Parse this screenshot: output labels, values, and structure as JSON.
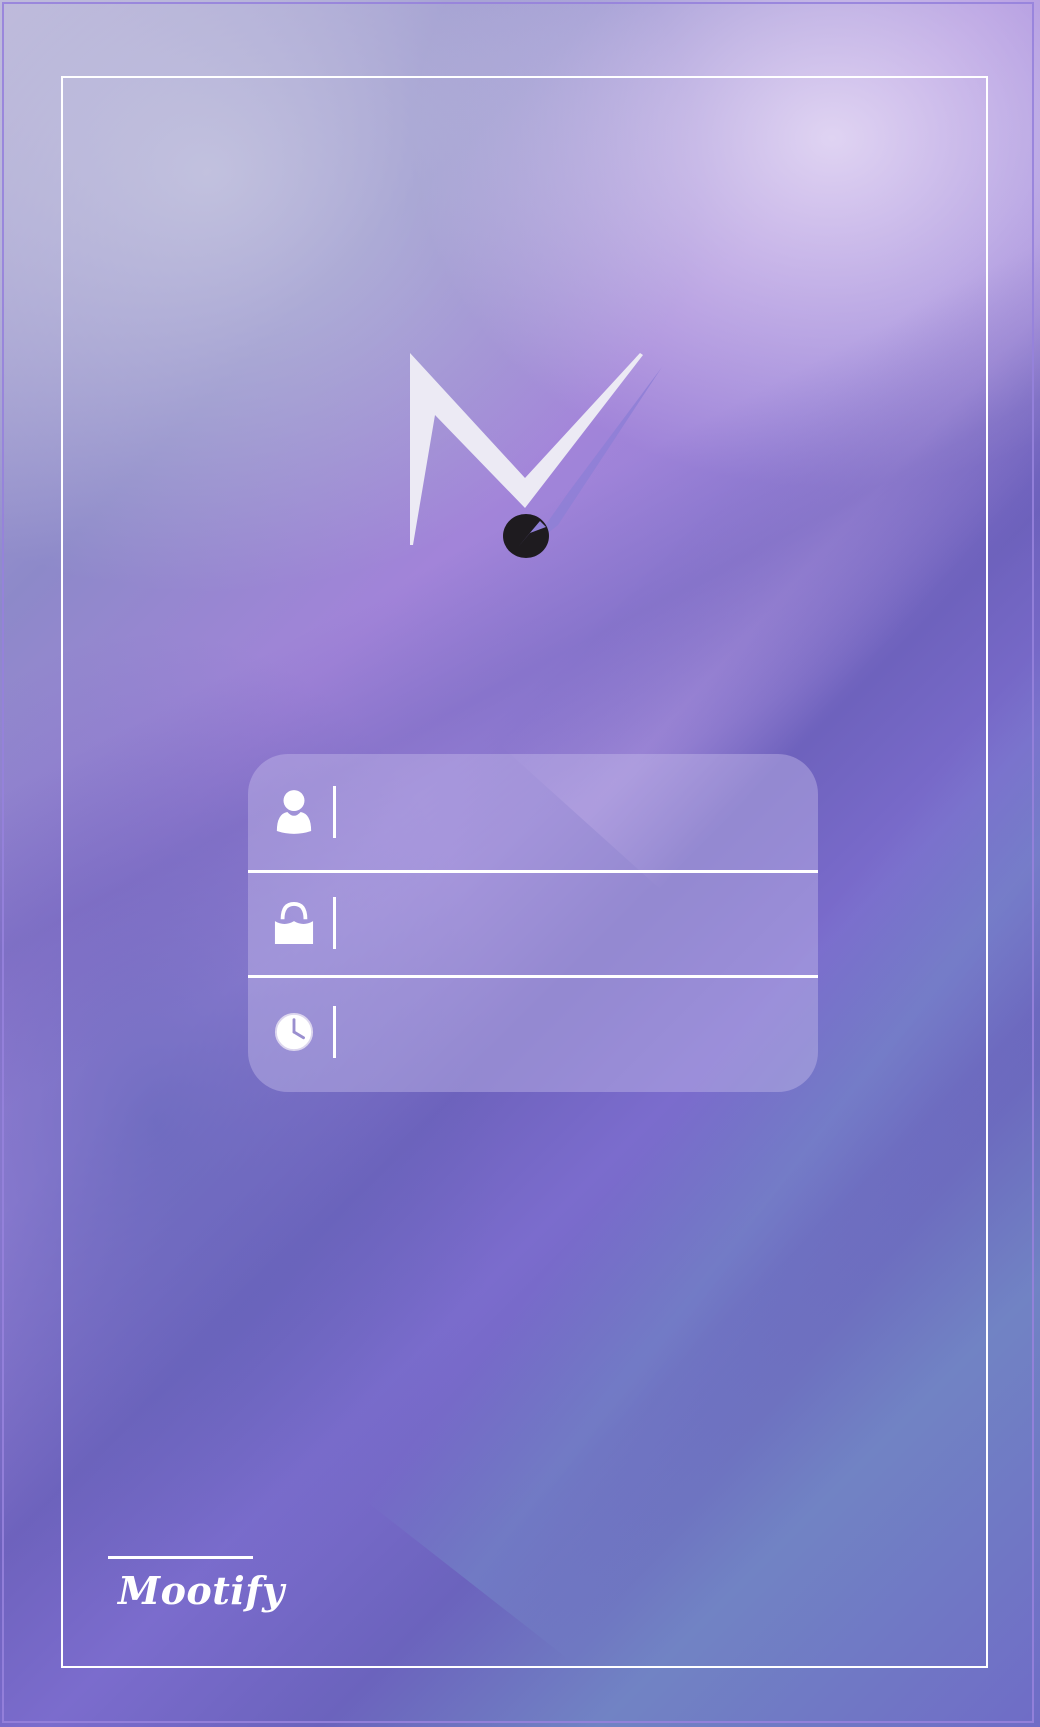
{
  "app": {
    "brand_name": "Mootify"
  },
  "login_form": {
    "username": {
      "value": "",
      "placeholder": "",
      "icon": "user-icon"
    },
    "password": {
      "value": "",
      "placeholder": "",
      "icon": "lock-icon"
    },
    "time": {
      "value": "",
      "placeholder": "",
      "icon": "clock-icon"
    }
  },
  "colors": {
    "frame": "#ffffff",
    "logo_light": "#eceaf4",
    "logo_shadow": "#8f7fd6",
    "logo_dot": "#1e1b1f"
  }
}
